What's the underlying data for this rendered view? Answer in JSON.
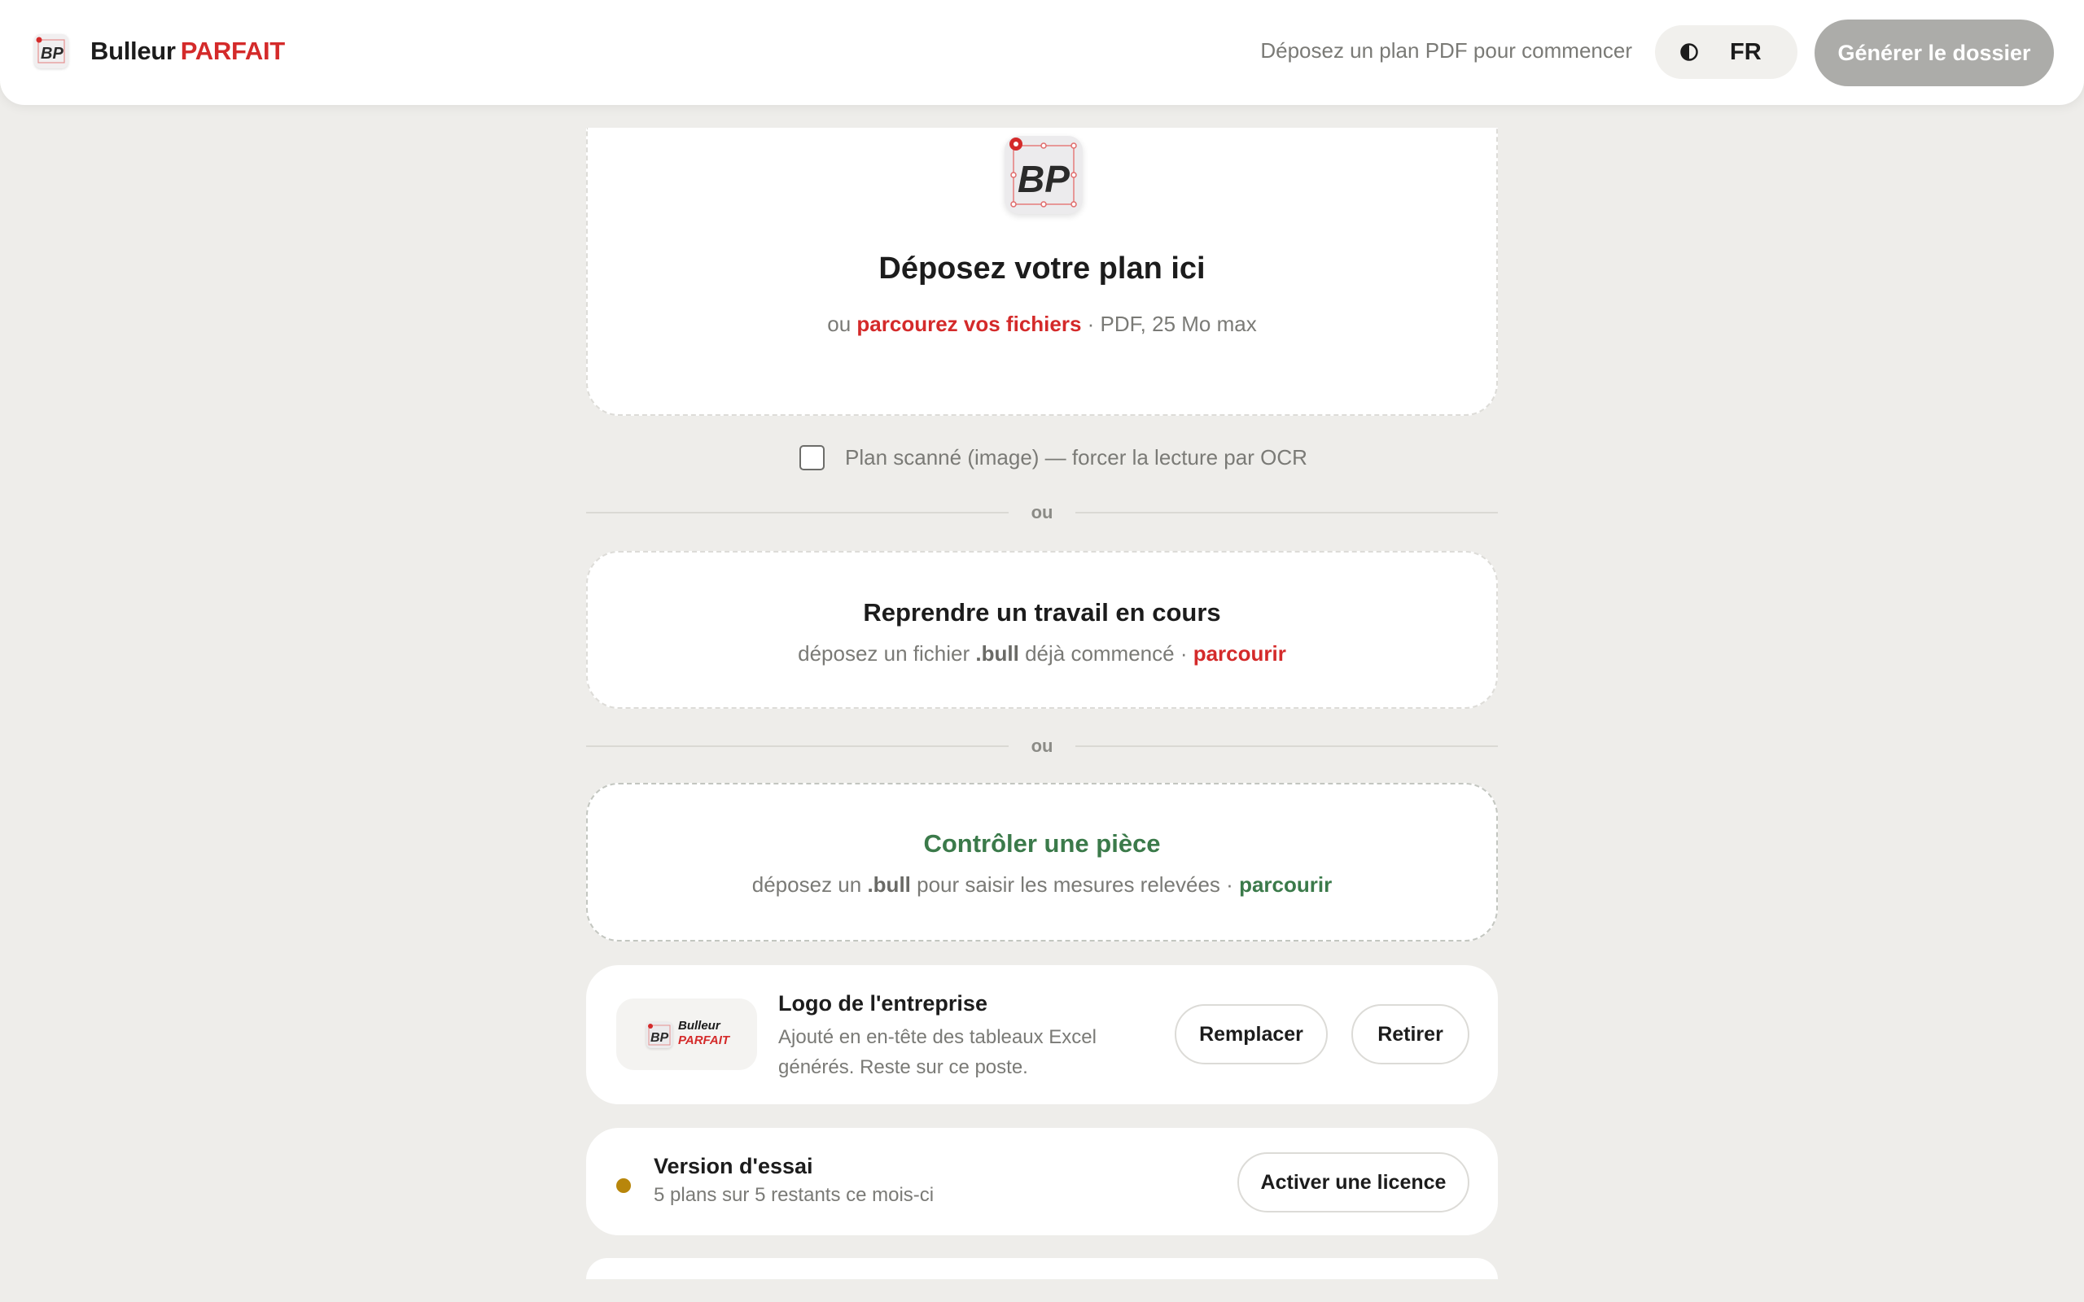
{
  "header": {
    "brand_first": "Bulleur",
    "brand_second": "PARFAIT",
    "logo_text": "BP",
    "hint": "Déposez un plan PDF pour commencer",
    "theme_icon": "contrast-icon",
    "lang": "FR",
    "generate_label": "Générer le dossier"
  },
  "drop": {
    "logo_text": "BP",
    "title": "Déposez votre plan ici",
    "sub_prefix": "ou",
    "browse_link": "parcourez vos fichiers",
    "sub_suffix": "· PDF, 25 Mo max"
  },
  "ocr": {
    "checked": false,
    "label": "Plan scanné (image) — forcer la lecture par OCR"
  },
  "divider_text": "ou",
  "resume": {
    "title": "Reprendre un travail en cours",
    "sub_prefix": "déposez un fichier",
    "ext": ".bull",
    "sub_middle": "déjà commencé ·",
    "link": "parcourir"
  },
  "control": {
    "title": "Contrôler une pièce",
    "sub_prefix": "déposez un",
    "ext": ".bull",
    "sub_middle": "pour saisir les mesures relevées ·",
    "link": "parcourir",
    "accent_color": "#3b7a4a"
  },
  "company_logo": {
    "preview_line1": "Bulleur",
    "preview_line2": "PARFAIT",
    "title": "Logo de l'entreprise",
    "desc_line1": "Ajouté en en-tête des tableaux Excel",
    "desc_line2": "générés. Reste sur ce poste.",
    "replace_label": "Remplacer",
    "remove_label": "Retirer"
  },
  "license": {
    "status_color": "#b8860b",
    "title": "Version d'essai",
    "sub": "5 plans sur 5 restants ce mois-ci",
    "activate_label": "Activer une licence"
  },
  "colors": {
    "brand_red": "#d42a2a",
    "background": "#eeedea",
    "disabled_button": "#acaca9"
  }
}
